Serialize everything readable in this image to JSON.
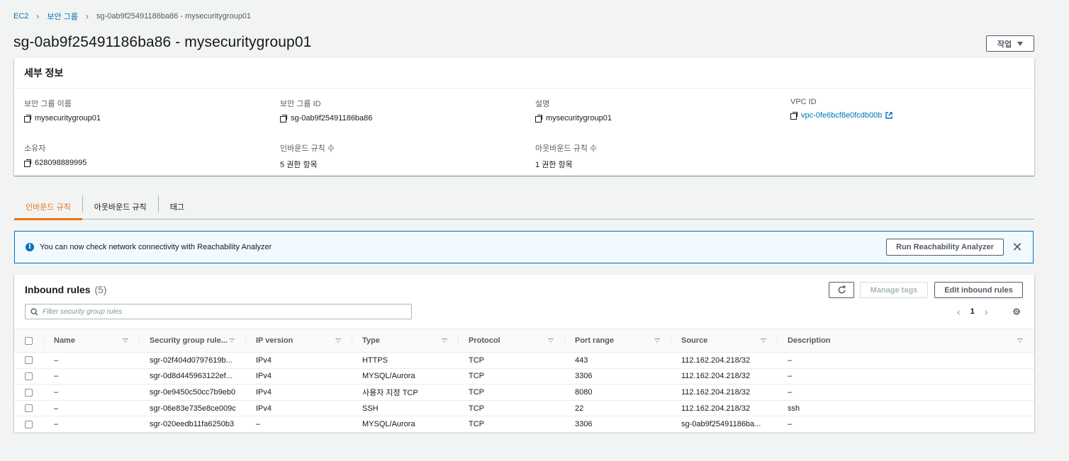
{
  "breadcrumb": {
    "ec2": "EC2",
    "security_groups": "보안 그룹",
    "current": "sg-0ab9f25491186ba86 - mysecuritygroup01"
  },
  "page": {
    "title": "sg-0ab9f25491186ba86 - mysecuritygroup01",
    "actions_label": "작업"
  },
  "details": {
    "header": "세부 정보",
    "sg_name": {
      "label": "보안 그룹 이름",
      "value": "mysecuritygroup01"
    },
    "sg_id": {
      "label": "보안 그룹 ID",
      "value": "sg-0ab9f25491186ba86"
    },
    "description": {
      "label": "설명",
      "value": "mysecuritygroup01"
    },
    "vpc_id": {
      "label": "VPC ID",
      "value": "vpc-0fe6bcf8e0fcdb00b"
    },
    "owner": {
      "label": "소유자",
      "value": "628098889995"
    },
    "inbound_count": {
      "label": "인바운드 규칙 수",
      "value": "5 권한 항목"
    },
    "outbound_count": {
      "label": "아웃바운드 규칙 수",
      "value": "1 권한 항목"
    }
  },
  "tabs": {
    "inbound": "인바운드 규칙",
    "outbound": "아웃바운드 규칙",
    "tags": "태그",
    "active": "inbound"
  },
  "flash": {
    "message": "You can now check network connectivity with Reachability Analyzer",
    "button": "Run Reachability Analyzer"
  },
  "rules": {
    "title": "Inbound rules",
    "count": "(5)",
    "manage_tags": "Manage tags",
    "edit_rules": "Edit inbound rules",
    "search_placeholder": "Filter security group rules",
    "page": "1",
    "columns": [
      "Name",
      "Security group rule...",
      "IP version",
      "Type",
      "Protocol",
      "Port range",
      "Source",
      "Description"
    ],
    "rows": [
      {
        "name": "–",
        "rule_id": "sgr-02f404d0797619b...",
        "ip_version": "IPv4",
        "type": "HTTPS",
        "protocol": "TCP",
        "port_range": "443",
        "source": "112.162.204.218/32",
        "description": "–"
      },
      {
        "name": "–",
        "rule_id": "sgr-0d8d445963122ef...",
        "ip_version": "IPv4",
        "type": "MYSQL/Aurora",
        "protocol": "TCP",
        "port_range": "3306",
        "source": "112.162.204.218/32",
        "description": "–"
      },
      {
        "name": "–",
        "rule_id": "sgr-0e9450c50cc7b9eb0",
        "ip_version": "IPv4",
        "type": "사용자 지정 TCP",
        "protocol": "TCP",
        "port_range": "8080",
        "source": "112.162.204.218/32",
        "description": "–"
      },
      {
        "name": "–",
        "rule_id": "sgr-06e83e735e8ce009c",
        "ip_version": "IPv4",
        "type": "SSH",
        "protocol": "TCP",
        "port_range": "22",
        "source": "112.162.204.218/32",
        "description": "ssh"
      },
      {
        "name": "–",
        "rule_id": "sgr-020eedb11fa6250b3",
        "ip_version": "–",
        "type": "MYSQL/Aurora",
        "protocol": "TCP",
        "port_range": "3306",
        "source": "sg-0ab9f25491186ba...",
        "description": "–"
      }
    ]
  },
  "colors": {
    "link": "#0073bb",
    "active_tab": "#ec7211",
    "info": "#0073bb"
  }
}
